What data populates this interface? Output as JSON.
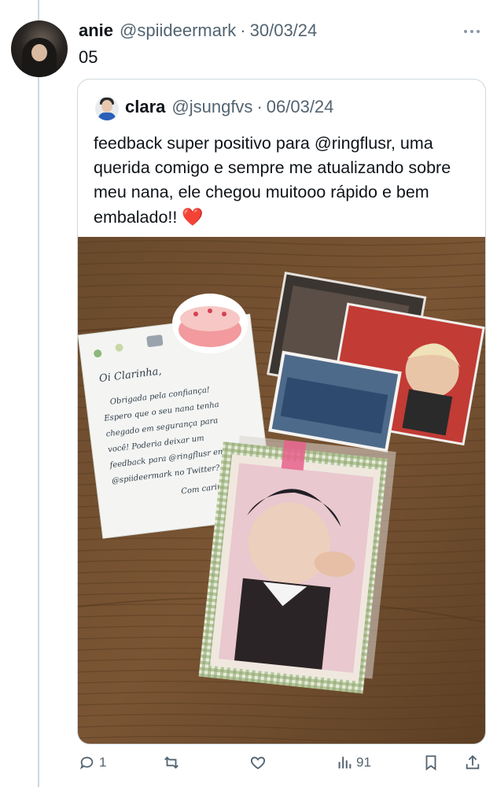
{
  "tweet": {
    "author_name": "anie",
    "author_handle": "@spiideermark",
    "separator": "·",
    "date": "30/03/24",
    "text": "05"
  },
  "quoted_tweet": {
    "author_name": "clara",
    "author_handle": "@jsungfvs",
    "separator": "·",
    "date": "06/03/24",
    "text": "feedback super positivo para @ringflusr, uma querida comigo e sempre me atualizando sobre meu nana, ele chegou muitooo rápido e bem embalado!!",
    "emoji": "❤️"
  },
  "photo_note": {
    "greeting": "Oi Clarinha,",
    "line1": "Obrigada pela confiança!",
    "line2": "Espero que o seu nana tenha",
    "line3": "chegado em segurança para",
    "line4": "você! Poderia deixar um",
    "line5": "feedback para @ringflusr em",
    "line6": "@spiideermark no Twitter?",
    "closing": "Com carinho,"
  },
  "actions": {
    "reply_count": "1",
    "retweet_count": "",
    "like_count": "",
    "views_count": "91"
  },
  "icons": {
    "more": "more-horizontal-icon",
    "reply": "reply-icon",
    "retweet": "retweet-icon",
    "like": "heart-icon",
    "views": "views-icon",
    "bookmark": "bookmark-icon",
    "share": "share-icon"
  },
  "colors": {
    "text_primary": "#0f1419",
    "text_secondary": "#536471",
    "border": "#cfd9de",
    "heart_red": "#d9112c"
  }
}
